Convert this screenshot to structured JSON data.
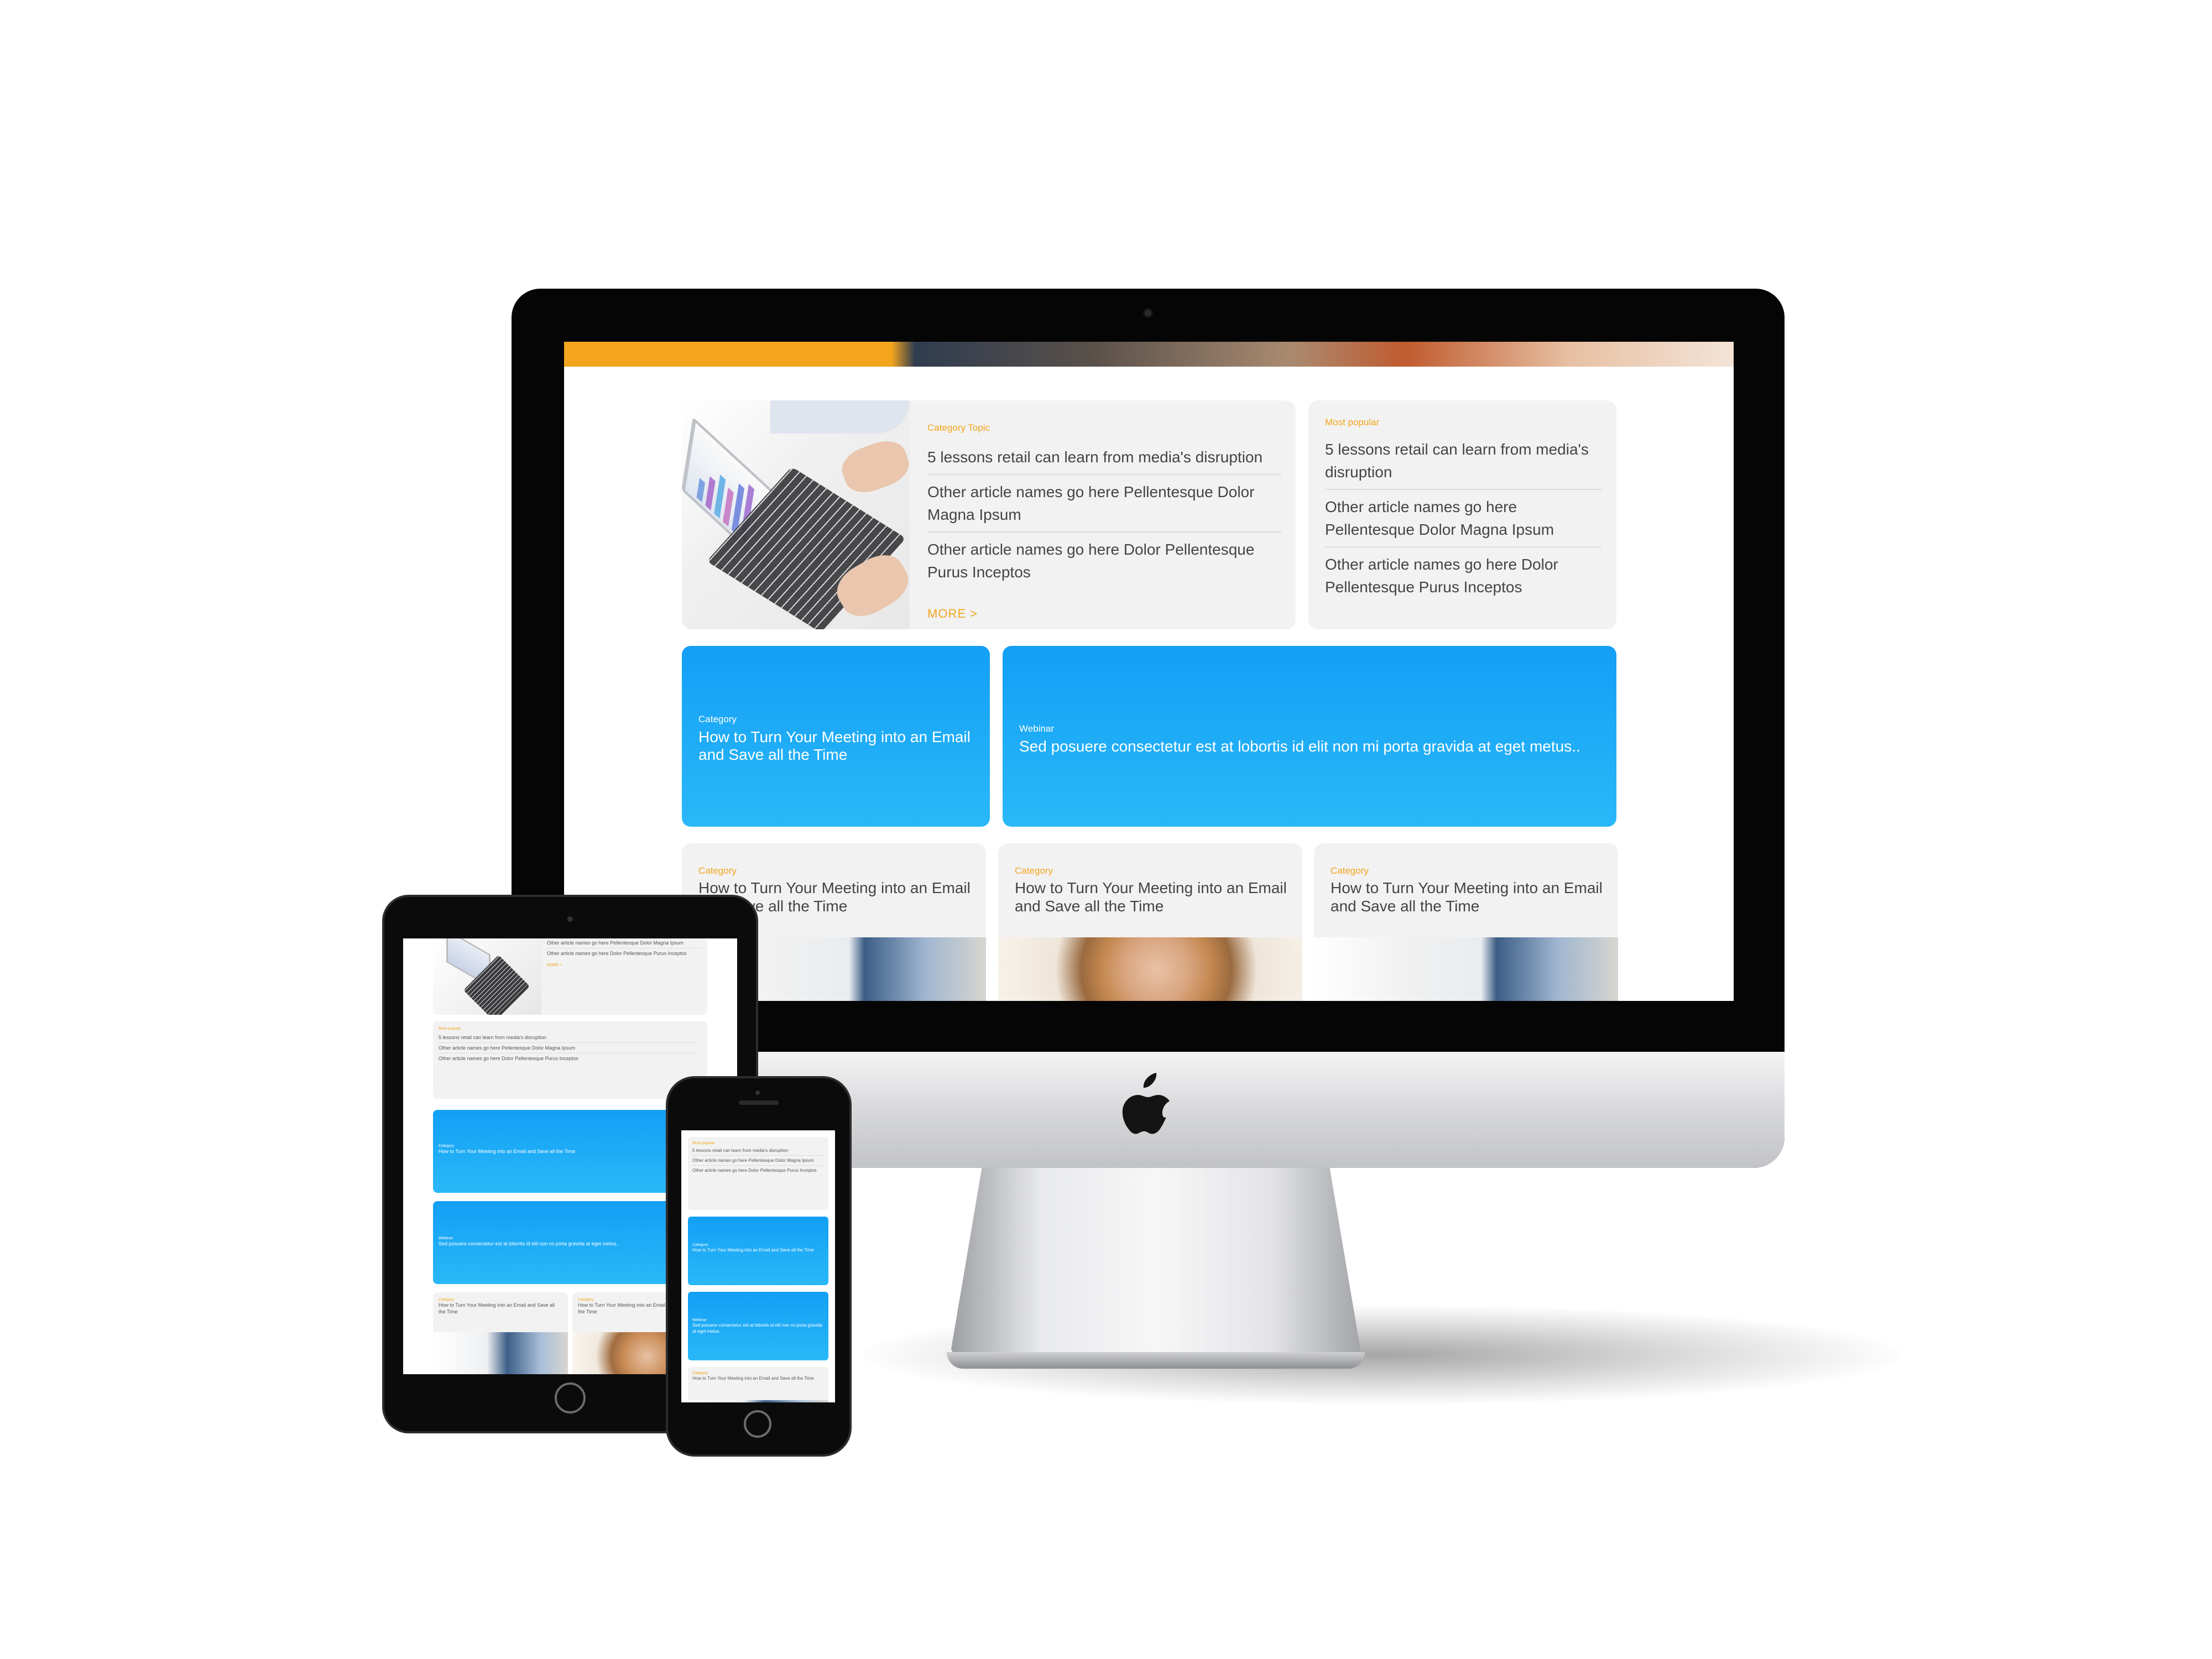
{
  "colors": {
    "accent": "#f3a51d",
    "blue_top": "#139ff5",
    "blue_bottom": "#2ab8f8",
    "card_bg": "#f2f2f2",
    "text": "#444444"
  },
  "desktop": {
    "featured": {
      "category": "Category Topic",
      "articles": [
        "5 lessons retail can learn from media's disruption",
        "Other article names go here Pellentesque Dolor Magna Ipsum",
        "Other article names go here Dolor Pellentesque Purus Inceptos"
      ],
      "more": "MORE >"
    },
    "popular": {
      "category": "Most popular",
      "articles": [
        "5 lessons retail can learn from media's disruption",
        "Other article names go here Pellentesque Dolor Magna Ipsum",
        "Other article names go here Dolor Pellentesque Purus Inceptos"
      ]
    },
    "blue_cards": [
      {
        "kicker": "Category",
        "title": "How to Turn Your Meeting into an Email and Save all the Time"
      },
      {
        "kicker": "Webinar",
        "title": "Sed posuere consectetur est at lobortis id elit non mi porta gravida at eget metus.."
      }
    ],
    "grid_cards": [
      {
        "kicker": "Category",
        "title": "How to Turn Your Meeting into an Email and Save all the Time"
      },
      {
        "kicker": "Category",
        "title": "How to Turn Your Meeting into an Email and Save all the Time"
      },
      {
        "kicker": "Category",
        "title": "How to Turn Your Meeting into an Email and Save all the Time"
      }
    ]
  },
  "tablet": {
    "featured_articles": [
      "Other article names go here Pellentesque Dolor Magna Ipsum",
      "Other article names go here Dolor Pellentesque Purus Inceptos"
    ],
    "more": "MORE >",
    "popular": {
      "category": "Most popular",
      "articles": [
        "5 lessons retail can learn from media's disruption",
        "Other article names go here Pellentesque Dolor Magna Ipsum",
        "Other article names go here Dolor Pellentesque Purus Inceptos"
      ]
    },
    "blue_cards": [
      {
        "kicker": "Category",
        "title": "How to Turn Your Meeting into an Email and Save all the Time"
      },
      {
        "kicker": "Webinar",
        "title": "Sed posuere consectetur est at lobortis id elit non mi porta gravida at eget metus.."
      }
    ],
    "grid_cards": [
      {
        "kicker": "Category",
        "title": "How to Turn Your Meeting into an Email and Save all the Time"
      },
      {
        "kicker": "Category",
        "title": "How to Turn Your Meeting into an Email and Save all the Time"
      }
    ]
  },
  "phone": {
    "popular": {
      "category": "Most popular",
      "articles": [
        "5 lessons retail can learn from media's disruption",
        "Other article names go here Pellentesque Dolor Magna Ipsum",
        "Other article names go here Dolor Pellentesque Purus Inceptos"
      ]
    },
    "blue_cards": [
      {
        "kicker": "Category",
        "title": "How to Turn Your Meeting into an Email and Save all the Time"
      },
      {
        "kicker": "Webinar",
        "title": "Sed posuere consectetur est at lobortis id elit non mi porta gravida at eget metus."
      }
    ],
    "grid_card": {
      "kicker": "Category",
      "title": "How to Turn Your Meeting into an Email and Save all the Time"
    }
  },
  "icons": {
    "apple": "apple-logo-icon"
  }
}
